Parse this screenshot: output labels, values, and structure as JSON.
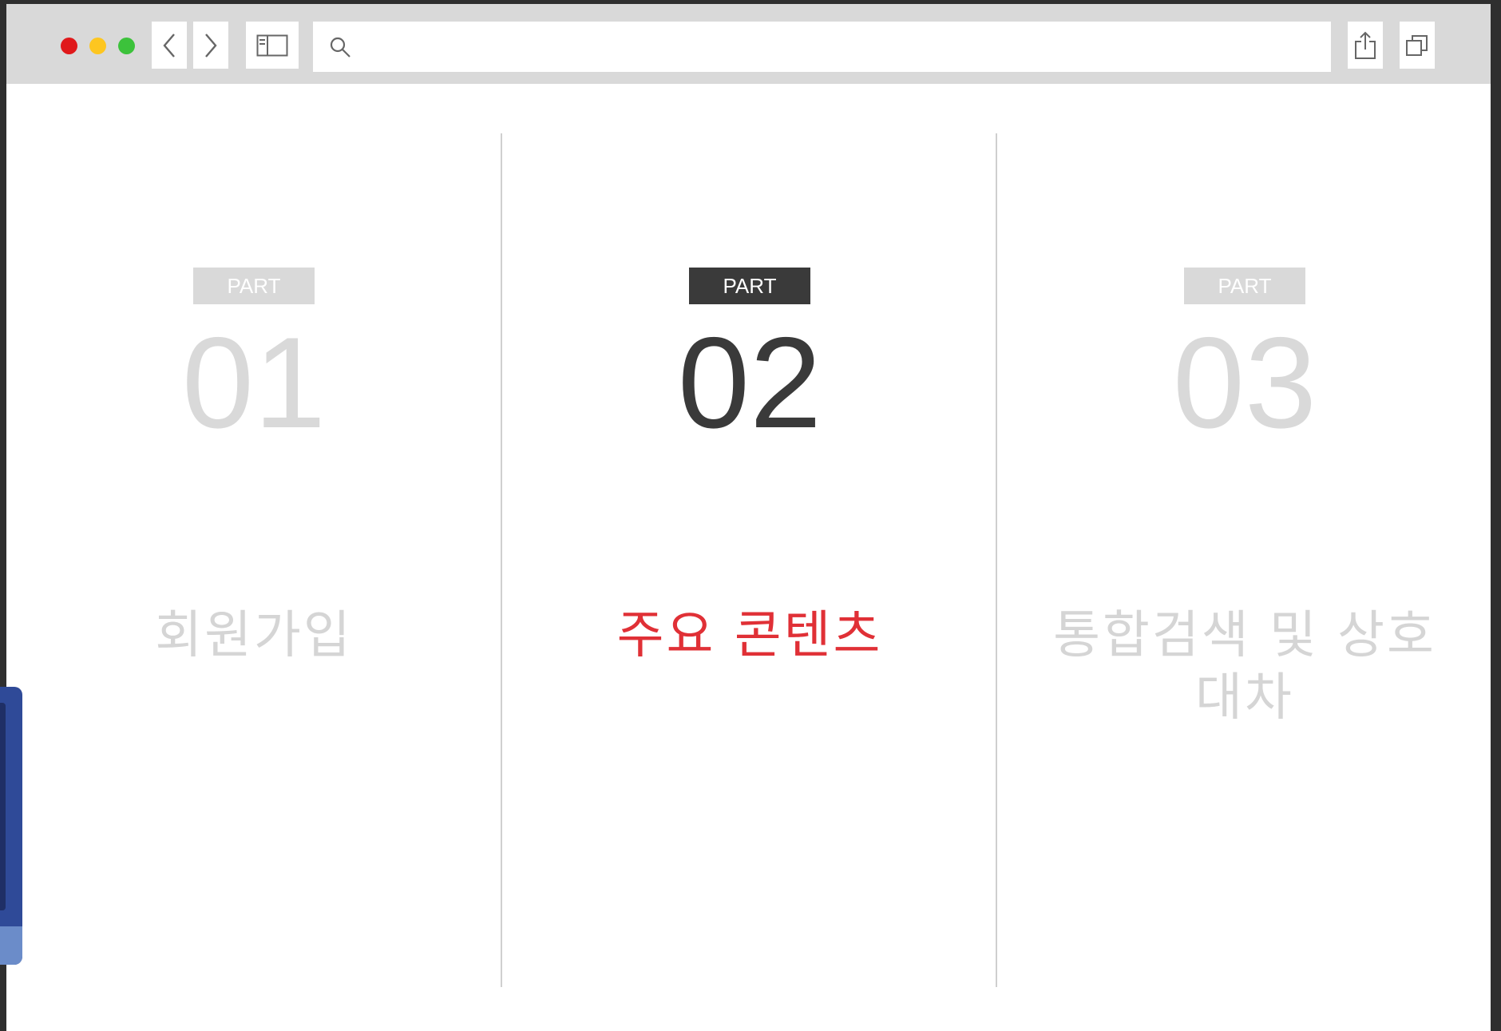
{
  "browser": {
    "address_value": "",
    "icons": {
      "back": "chevron-left-icon",
      "forward": "chevron-right-icon",
      "sidebar": "sidebar-icon",
      "search": "search-icon",
      "share": "share-icon",
      "tabs": "tabs-icon"
    },
    "traffic_lights": [
      "#e0191b",
      "#fdc620",
      "#3cc23b"
    ]
  },
  "parts": [
    {
      "badge": "PART",
      "number": "01",
      "title": "회원가입",
      "active": false
    },
    {
      "badge": "PART",
      "number": "02",
      "title": "주요 콘텐츠",
      "active": true
    },
    {
      "badge": "PART",
      "number": "03",
      "title": "통합검색 및 상호대차",
      "active": false
    }
  ],
  "colors": {
    "active_dark": "#3a3a3a",
    "active_title": "#e03036",
    "inactive": "#d9d9d9"
  }
}
